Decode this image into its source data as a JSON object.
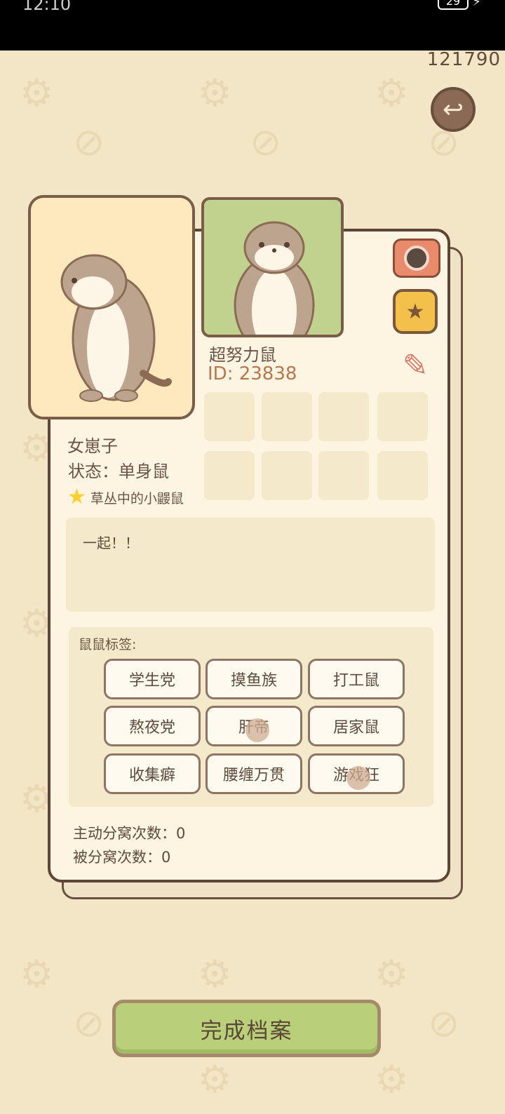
{
  "status_bar": {
    "time": "12:10",
    "battery": "29"
  },
  "coins": "121790",
  "profile": {
    "nickname": "超努力鼠",
    "id": "ID: 23838",
    "gender": "女崽子",
    "status": "状态：单身鼠",
    "title": "草丛中的小鼹鼠",
    "bio": "一起！！"
  },
  "tags": {
    "label": "鼠鼠标签:",
    "items": [
      "学生党",
      "摸鱼族",
      "打工鼠",
      "熬夜党",
      "肝帝",
      "居家鼠",
      "收集癖",
      "腰缠万贯",
      "游戏狂"
    ]
  },
  "stats": {
    "active_split": "主动分窝次数：0",
    "passive_split": "被分窝次数：0"
  },
  "finish_button": "完成档案",
  "icons": {
    "back": "back-arrow-icon",
    "camera": "camera-icon",
    "frame": "photo-frame-icon",
    "edit": "pencil-icon",
    "title_badge": "star-icon"
  },
  "colors": {
    "background": "#f3e6c6",
    "card": "#fdf5e1",
    "button": "#b9cf7a",
    "id_text": "#b8774f"
  }
}
